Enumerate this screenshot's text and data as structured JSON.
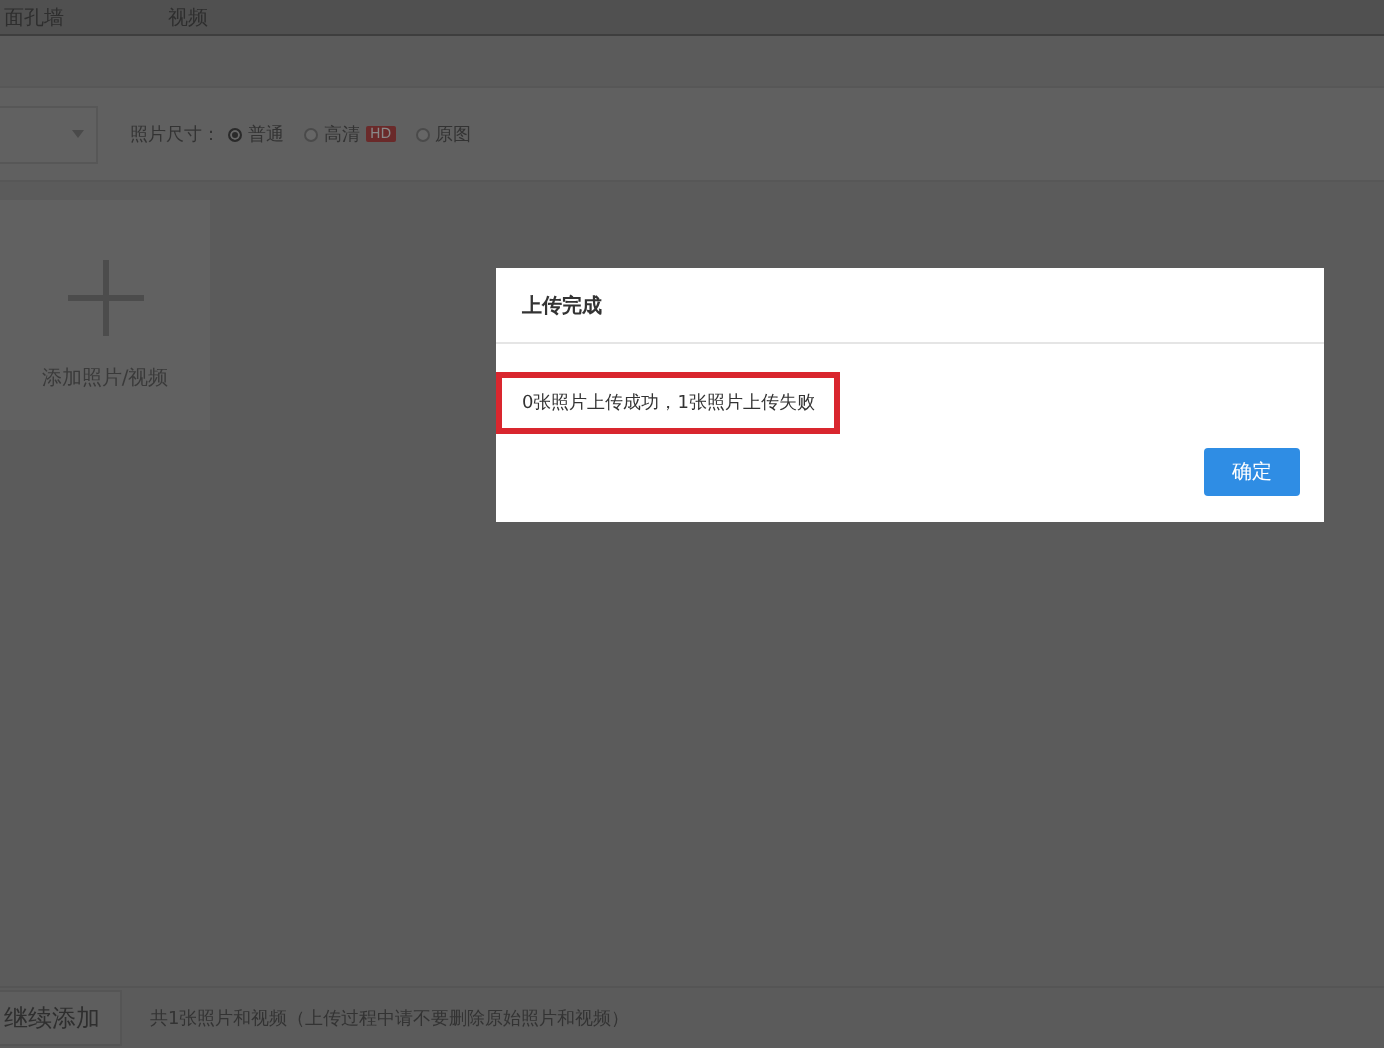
{
  "tabs": [
    {
      "label": "面孔墙",
      "selected": false
    },
    {
      "label": "视频",
      "selected": false
    }
  ],
  "toolbar": {
    "size_label": "照片尺寸：",
    "size_options": [
      {
        "label": "普通",
        "selected": true
      },
      {
        "label": "高清",
        "selected": false,
        "badge": "HD"
      },
      {
        "label": "原图",
        "selected": false
      }
    ]
  },
  "add_tile": {
    "label": "添加照片/视频"
  },
  "footer": {
    "button": "继续添加",
    "summary": "共1张照片和视频（上传过程中请不要删除原始照片和视频）"
  },
  "dialog": {
    "title": "上传完成",
    "message": "0张照片上传成功，1张照片上传失败",
    "button": "确定"
  }
}
